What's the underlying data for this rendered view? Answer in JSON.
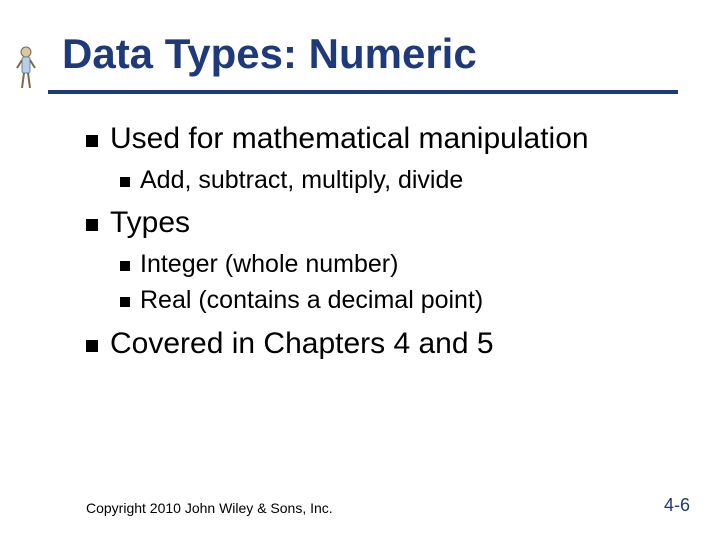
{
  "title": "Data Types: Numeric",
  "bullets": {
    "b1": "Used for mathematical manipulation",
    "b1a": "Add, subtract, multiply, divide",
    "b2": "Types",
    "b2a": "Integer (whole number)",
    "b2b": "Real (contains a decimal point)",
    "b3": "Covered in Chapters 4 and 5"
  },
  "footer": {
    "copyright": "Copyright 2010 John Wiley & Sons, Inc.",
    "pagenum": "4-6"
  }
}
